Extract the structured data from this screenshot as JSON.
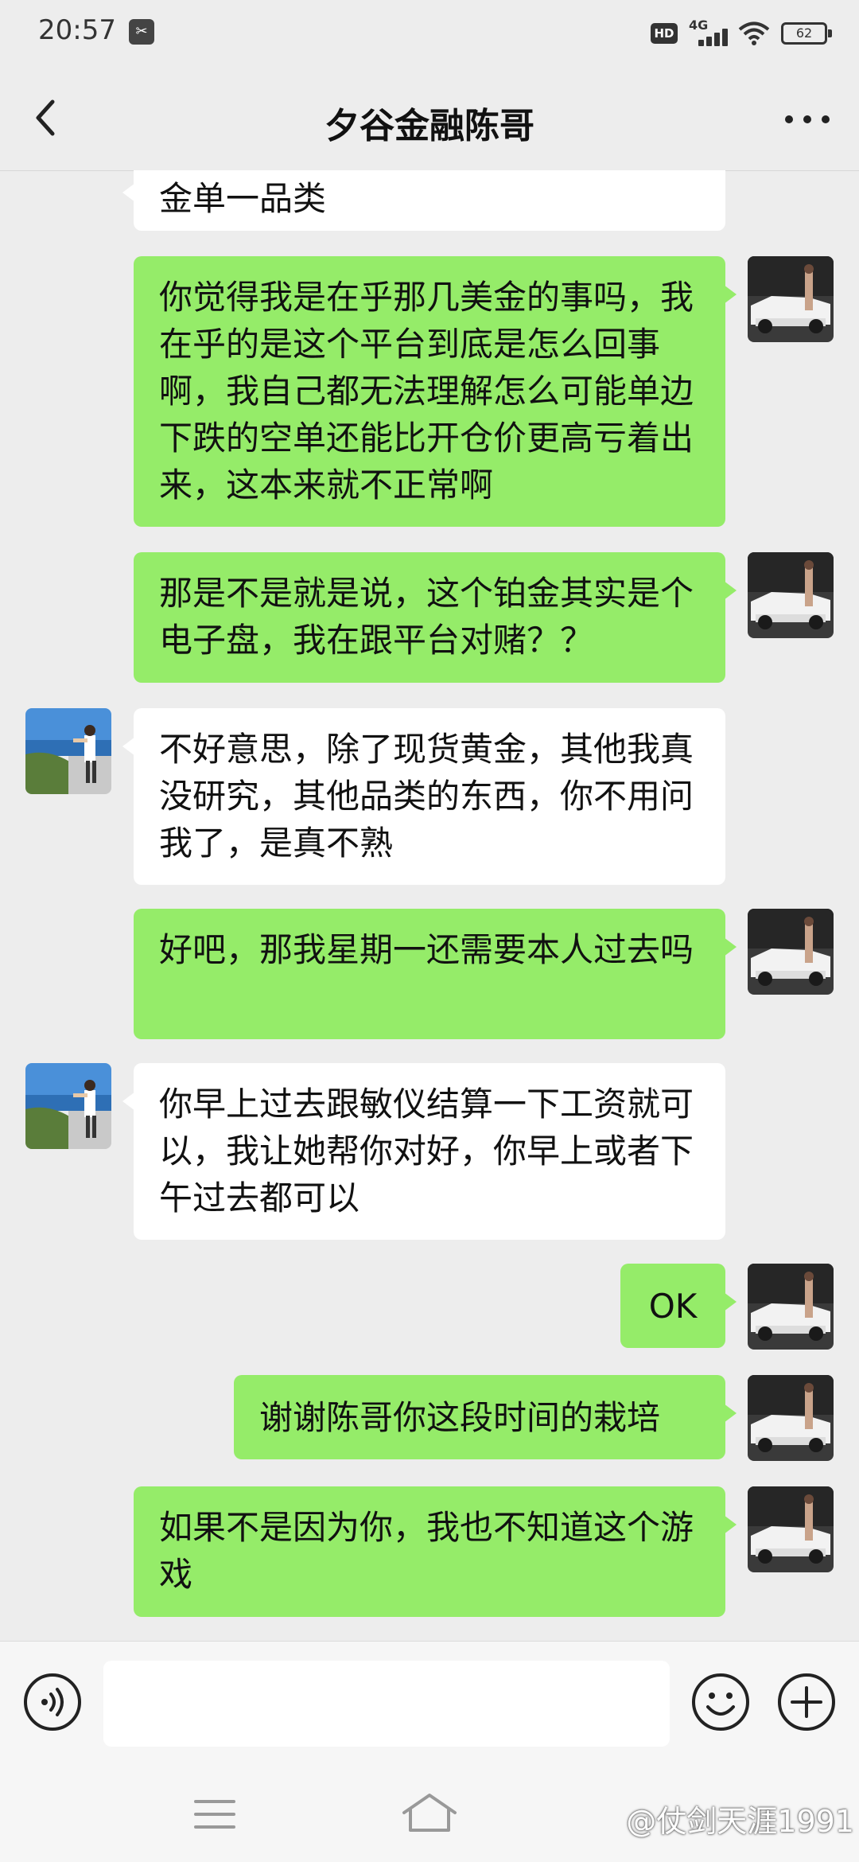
{
  "status_bar": {
    "time": "20:57",
    "hd": "HD",
    "network": "4G",
    "battery": "62"
  },
  "header": {
    "title": "夕谷金融陈哥",
    "back_icon": "chevron-left-icon",
    "more_icon": "more-dots-icon"
  },
  "messages": [
    {
      "side": "in",
      "text": "金单一品类"
    },
    {
      "side": "out",
      "text": "你觉得我是在乎那几美金的事吗，我在乎的是这个平台到底是怎么回事啊，我自己都无法理解怎么可能单边下跌的空单还能比开仓价更高亏着出来，这本来就不正常啊"
    },
    {
      "side": "out",
      "text": "那是不是就是说，这个铂金其实是个电子盘，我在跟平台对赌？？"
    },
    {
      "side": "in",
      "text": "不好意思，除了现货黄金，其他我真没研究，其他品类的东西，你不用问我了，是真不熟"
    },
    {
      "side": "out",
      "text": "好吧，那我星期一还需要本人过去吗"
    },
    {
      "side": "in",
      "text": "你早上过去跟敏仪结算一下工资就可以，我让她帮你对好，你早上或者下午过去都可以"
    },
    {
      "side": "out",
      "text": "OK"
    },
    {
      "side": "out",
      "text": "谢谢陈哥你这段时间的栽培"
    },
    {
      "side": "out",
      "text": "如果不是因为你，我也不知道这个游戏"
    }
  ],
  "input_bar": {
    "placeholder": "",
    "voice_icon": "voice-icon",
    "emoji_icon": "emoji-icon",
    "plus_icon": "plus-icon"
  },
  "system_nav": {
    "menu_icon": "menu-icon",
    "home_icon": "home-icon"
  },
  "watermark": "@仗剑天涯1991",
  "colors": {
    "outgoing_bubble": "#95ec69",
    "incoming_bubble": "#ffffff",
    "background": "#ededed"
  }
}
